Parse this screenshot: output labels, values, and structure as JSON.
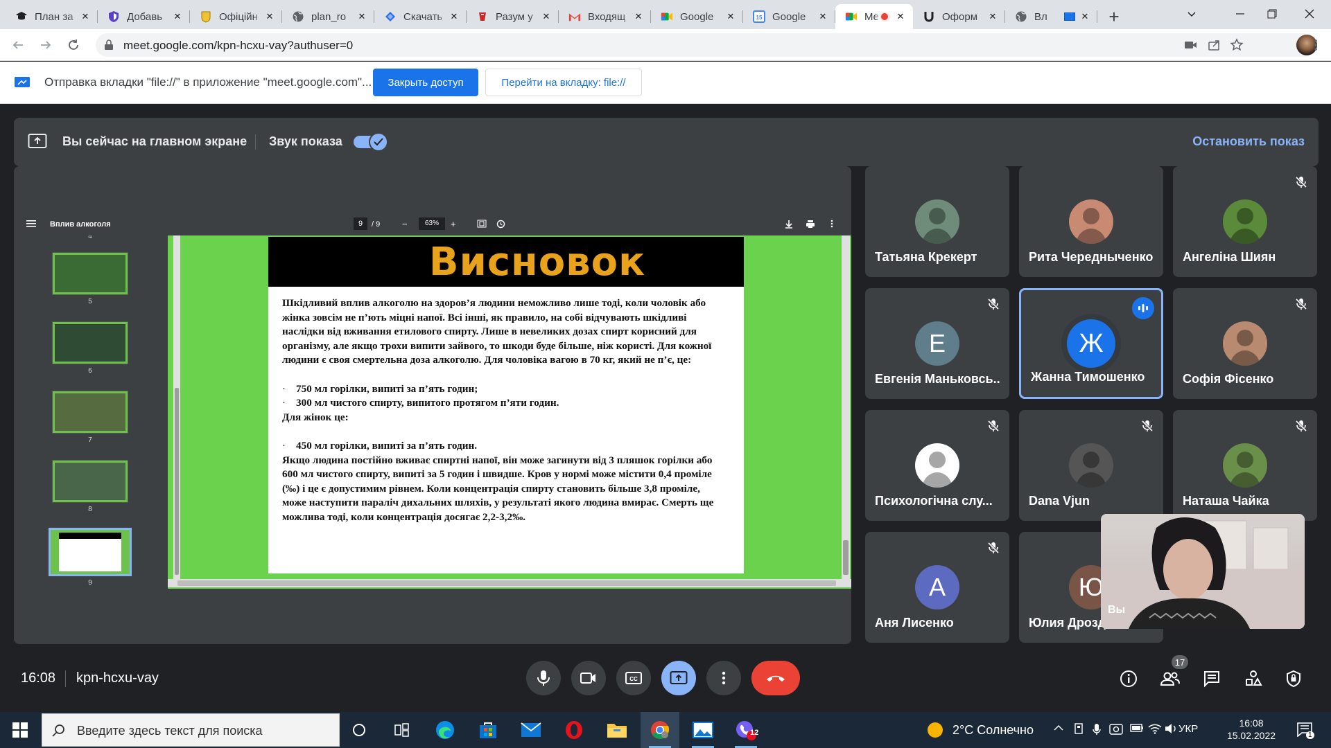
{
  "browser": {
    "tabs": [
      {
        "title": "План за",
        "icon": "graduation-cap-icon"
      },
      {
        "title": "Добавь",
        "icon": "shield-icon"
      },
      {
        "title": "Офіційн",
        "icon": "coat-of-arms-icon"
      },
      {
        "title": "plan_ro",
        "icon": "globe-icon"
      },
      {
        "title": "Скачать",
        "icon": "blue-diamond-icon"
      },
      {
        "title": "Разум у",
        "icon": "brain-icon"
      },
      {
        "title": "Входящ",
        "icon": "gmail-icon"
      },
      {
        "title": "Google",
        "icon": "google-meet-icon"
      },
      {
        "title": "Google",
        "icon": "google-calendar-icon"
      },
      {
        "title": "Me",
        "icon": "google-meet-icon",
        "active": true,
        "recording": true
      },
      {
        "title": "Оформ",
        "icon": "u-logo-icon"
      },
      {
        "title": "Вл",
        "icon": "globe-icon"
      }
    ],
    "url": "meet.google.com/kpn-hcxu-vay?authuser=0"
  },
  "infobar": {
    "text": "Отправка вкладки \"file://\" в приложение \"meet.google.com\"...",
    "stop_access": "Закрыть доступ",
    "goto_tab": "Перейти на вкладку: file://"
  },
  "presenting": {
    "status": "Вы сейчас на главном экране",
    "sound_label": "Звук показа",
    "sound_on": true,
    "stop": "Остановить показ"
  },
  "pdf": {
    "title": "Вплив алкоголя",
    "page": "9",
    "of": "/  9",
    "zoom": "63%",
    "thumbnails": [
      "4",
      "5",
      "6",
      "7",
      "8",
      "9"
    ],
    "slide": {
      "title": "Висновок",
      "para1": "Шкідливий вплив алкоголю на здоров’я людини неможливо лише тоді, коли чоловік або жінка зовсім не п’ють міцні напої. Всі інші, як правило, на собі відчувають шкідливі наслідки від вживання етилового спирту. Лише в невеликих дозах спирт корисний для організму, але якщо трохи випити зайвого, то шкоди буде більше, ніж користі. Для кожної людини є своя смертельна доза алкоголю. Для чоловіка вагою в 70 кг, який не п’є, це:",
      "bullet1": "750 мл горілки, випиті за п’ять годин;",
      "bullet2": "300 мл чистого спирту, випитого протягом п’яти годин.",
      "women": "Для жінок це:",
      "bullet3": "450 мл горілки, випиті за п’ять годин.",
      "para2": "Якщо людина постійно вживає спиртні напої, він може загинути від 3 пляшок горілки або 600 мл чистого спирту, випиті за 5 годин і швидше. Кров у нормі може містити 0,4 проміле (‰) і це є допустимим рівнем. Коли концентрація спирту становить більше 3,8 проміле, може наступити параліч дихальних шляхів, у результаті якого людина вмирає. Смерть ще можлива тоді, коли концентрація досягає 2,2-3,2‰."
    }
  },
  "participants": [
    {
      "name": "Татьяна Крекерт",
      "avatar": "photo",
      "color": "#6f8c7a",
      "muted": false
    },
    {
      "name": "Рита Чередныченко",
      "avatar": "photo",
      "color": "#c98a73",
      "muted": false
    },
    {
      "name": "Ангеліна Шиян",
      "avatar": "photo",
      "color": "#5a8a3a",
      "muted": true
    },
    {
      "name": "Евгенія Маньковсь...",
      "avatar": "Е",
      "color": "#607d8b",
      "muted": true
    },
    {
      "name": "Жанна Тимошенко",
      "avatar": "Ж",
      "color": "#1a73e8",
      "muted": false,
      "speaking": true
    },
    {
      "name": "Софія Фісенко",
      "avatar": "photo",
      "color": "#b88a70",
      "muted": true
    },
    {
      "name": "Психологічна слу...",
      "avatar": "photo",
      "color": "#ffffff",
      "muted": true
    },
    {
      "name": "Dana Vjun",
      "avatar": "photo",
      "color": "#555555",
      "muted": true
    },
    {
      "name": "Наташа Чайка",
      "avatar": "photo",
      "color": "#6a8f4a",
      "muted": true
    },
    {
      "name": "Аня Лисенко",
      "avatar": "А",
      "color": "#5c6bc0",
      "muted": true
    },
    {
      "name": "Юлия Дрозд",
      "avatar": "Ю",
      "color": "#795548",
      "muted": false
    }
  ],
  "self_view_label": "Вы",
  "meeting": {
    "time": "16:08",
    "code": "kpn-hcxu-vay",
    "people_count": "17"
  },
  "taskbar": {
    "search_placeholder": "Введите здесь текст для поиска",
    "weather": "2°C  Солнечно",
    "lang": "УКР",
    "time": "16:08",
    "date": "15.02.2022",
    "viber_badge": "12",
    "notif_badge": "1"
  }
}
